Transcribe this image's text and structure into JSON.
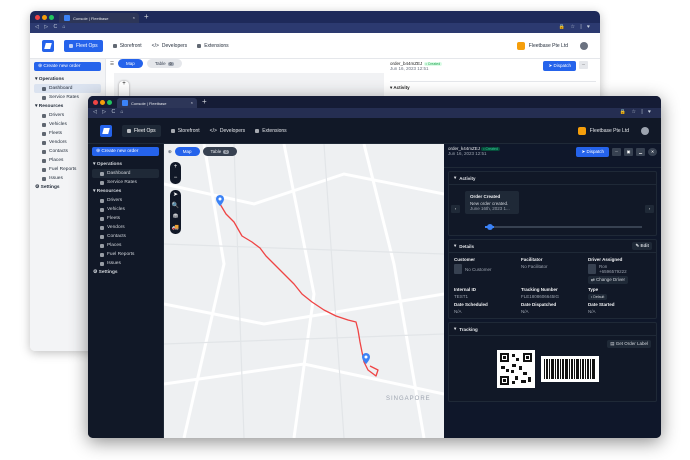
{
  "browser": {
    "tab_title": "Console | Fleetbase",
    "tab_close": "×",
    "new_tab": "+",
    "nav_glyphs": "◁ ▷ C ⌂",
    "url_glyphs": "🔒 ☆ | ♥"
  },
  "app": {
    "nav": [
      {
        "label": "Fleet Ops",
        "icon": "map-icon",
        "active": true
      },
      {
        "label": "Storefront",
        "icon": "store-icon",
        "active": false
      },
      {
        "label": "Developers",
        "icon": "code-icon",
        "active": false
      },
      {
        "label": "Extensions",
        "icon": "puzzle-icon",
        "active": false
      }
    ],
    "org_name": "Fleetbase Pte Ltd"
  },
  "sidebar": {
    "create_label": "Create new order",
    "operations_label": "Operations",
    "dashboard_label": "Dashboard",
    "service_rates_label": "Service Rates",
    "resources_label": "Resources",
    "resources": [
      "Drivers",
      "Vehicles",
      "Fleets",
      "Vendors",
      "Contacts",
      "Places",
      "Fuel Reports",
      "Issues"
    ],
    "settings_label": "Settings"
  },
  "map": {
    "map_label": "Map",
    "table_label": "Table",
    "table_count": "0",
    "city_label": "SINGAPORE",
    "controls": [
      "+",
      "−",
      "➤",
      "🔍",
      "⛃",
      "🚚"
    ]
  },
  "order": {
    "id": "order_k44mZEJ",
    "status": "• Created",
    "date": "Jun 16, 2023 12:51",
    "dispatch_label": "Dispatch",
    "more_label": "···"
  },
  "activity": {
    "title": "Activity",
    "event_title": "Order Created",
    "event_desc": "New order created.",
    "event_date": "June 16th, 2023 1..."
  },
  "details": {
    "title": "Details",
    "edit_label": "Edit",
    "customer_label": "Customer",
    "customer_value": "No Customer",
    "facilitator_label": "Facilitator",
    "facilitator_value": "No Facilitator",
    "driver_label": "Driver Assigned",
    "driver_name": "Ron",
    "driver_phone": "+6596579222",
    "change_driver_label": "Change Driver",
    "internal_id_label": "Internal ID",
    "internal_id_value": "TEST1",
    "tracking_label": "Tracking Number",
    "tracking_value": "FLE1808606645IG",
    "type_label": "Type",
    "type_value": "• Default",
    "scheduled_label": "Date Scheduled",
    "scheduled_value": "N/A",
    "dispatched_label": "Date Dispatched",
    "dispatched_value": "N/A",
    "started_label": "Date Started",
    "started_value": "N/A"
  },
  "tracking": {
    "title": "Tracking",
    "label_button": "Get Order Label"
  },
  "back_window": {
    "order_id": "order_b44mZEJ",
    "date": "Jun 16, 2023 12:51",
    "status": "• Created"
  },
  "colors": {
    "accent": "#2563eb",
    "route": "#ef4444",
    "pin": "#3b82f6",
    "dark_bg": "#0f172a"
  }
}
